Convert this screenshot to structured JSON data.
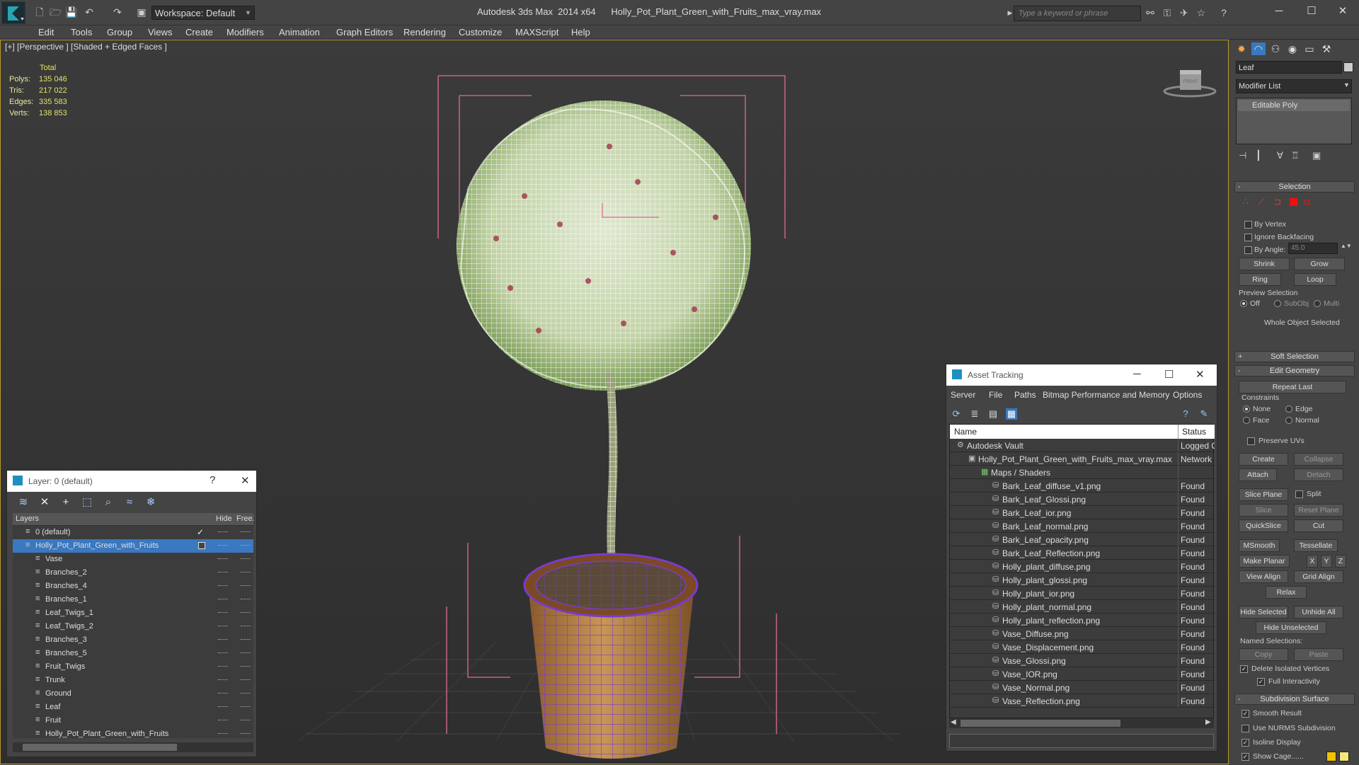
{
  "titlebar": {
    "workspace": "Workspace: Default",
    "app_title": "Autodesk 3ds Max  2014 x64      Holly_Pot_Plant_Green_with_Fruits_max_vray.max",
    "search_placeholder": "Type a keyword or phrase",
    "min": "─",
    "max": "☐",
    "close": "✕"
  },
  "menu": [
    "Edit",
    "Tools",
    "Group",
    "Views",
    "Create",
    "Modifiers",
    "Animation",
    "Graph Editors",
    "Rendering",
    "Customize",
    "MAXScript",
    "Help"
  ],
  "viewport": {
    "label": "[+] [Perspective ] [Shaded + Edged Faces ]",
    "viewcube_label": "FRONT",
    "stats": {
      "header": "Total",
      "rows": [
        {
          "label": "Polys:",
          "value": "135 046"
        },
        {
          "label": "Tris:",
          "value": "217 022"
        },
        {
          "label": "Edges:",
          "value": "335 583"
        },
        {
          "label": "Verts:",
          "value": "138 853"
        }
      ]
    },
    "colors": {
      "leaf": "#7a9c55",
      "wire": "#ffffff",
      "pot": "#b27b3b",
      "potwire": "#7a3ad0",
      "bbox": "#e06a9a"
    }
  },
  "layer_panel": {
    "title": "Layer: 0 (default)",
    "help": "?",
    "close": "✕",
    "col_layers": "Layers",
    "col_hide": "Hide",
    "col_freeze": "Freeze",
    "layers": [
      {
        "name": "0 (default)",
        "indent": 1,
        "check": "✓"
      },
      {
        "name": "Holly_Pot_Plant_Green_with_Fruits",
        "indent": 1,
        "selected": true
      },
      {
        "name": "Vase",
        "indent": 2
      },
      {
        "name": "Branches_2",
        "indent": 2
      },
      {
        "name": "Branches_4",
        "indent": 2
      },
      {
        "name": "Branches_1",
        "indent": 2
      },
      {
        "name": "Leaf_Twigs_1",
        "indent": 2
      },
      {
        "name": "Leaf_Twigs_2",
        "indent": 2
      },
      {
        "name": "Branches_3",
        "indent": 2
      },
      {
        "name": "Branches_5",
        "indent": 2
      },
      {
        "name": "Fruit_Twigs",
        "indent": 2
      },
      {
        "name": "Trunk",
        "indent": 2
      },
      {
        "name": "Ground",
        "indent": 2
      },
      {
        "name": "Leaf",
        "indent": 2
      },
      {
        "name": "Fruit",
        "indent": 2
      },
      {
        "name": "Holly_Pot_Plant_Green_with_Fruits",
        "indent": 2
      }
    ]
  },
  "asset_panel": {
    "title": "Asset Tracking",
    "min": "─",
    "max": "☐",
    "close": "✕",
    "menu": [
      "Server",
      "File",
      "Paths",
      "Bitmap Performance and Memory",
      "Options"
    ],
    "col_name": "Name",
    "col_status": "Status",
    "rows": [
      {
        "name": "Autodesk Vault",
        "status": "Logged Out",
        "indent": 1
      },
      {
        "name": "Holly_Pot_Plant_Green_with_Fruits_max_vray.max",
        "status": "Network Path",
        "indent": 2
      },
      {
        "name": "Maps / Shaders",
        "status": "",
        "indent": 3
      },
      {
        "name": "Bark_Leaf_diffuse_v1.png",
        "status": "Found",
        "indent": 4
      },
      {
        "name": "Bark_Leaf_Glossi.png",
        "status": "Found",
        "indent": 4
      },
      {
        "name": "Bark_Leaf_ior.png",
        "status": "Found",
        "indent": 4
      },
      {
        "name": "Bark_Leaf_normal.png",
        "status": "Found",
        "indent": 4
      },
      {
        "name": "Bark_Leaf_opacity.png",
        "status": "Found",
        "indent": 4
      },
      {
        "name": "Bark_Leaf_Reflection.png",
        "status": "Found",
        "indent": 4
      },
      {
        "name": "Holly_plant_diffuse.png",
        "status": "Found",
        "indent": 4
      },
      {
        "name": "Holly_plant_glossi.png",
        "status": "Found",
        "indent": 4
      },
      {
        "name": "Holly_plant_ior.png",
        "status": "Found",
        "indent": 4
      },
      {
        "name": "Holly_plant_normal.png",
        "status": "Found",
        "indent": 4
      },
      {
        "name": "Holly_plant_reflection.png",
        "status": "Found",
        "indent": 4
      },
      {
        "name": "Vase_Diffuse.png",
        "status": "Found",
        "indent": 4
      },
      {
        "name": "Vase_Displacement.png",
        "status": "Found",
        "indent": 4
      },
      {
        "name": "Vase_Glossi.png",
        "status": "Found",
        "indent": 4
      },
      {
        "name": "Vase_IOR.png",
        "status": "Found",
        "indent": 4
      },
      {
        "name": "Vase_Normal.png",
        "status": "Found",
        "indent": 4
      },
      {
        "name": "Vase_Reflection.png",
        "status": "Found",
        "indent": 4
      }
    ]
  },
  "command_panel": {
    "object_name": "Leaf",
    "modifier_list": "Modifier List",
    "stack_item": "Editable Poly",
    "selection": {
      "title": "Selection",
      "by_vertex": "By Vertex",
      "ignore_backfacing": "Ignore Backfacing",
      "by_angle": "By Angle:",
      "angle_value": "45.0",
      "shrink": "Shrink",
      "grow": "Grow",
      "ring": "Ring",
      "loop": "Loop",
      "preview_selection": "Preview Selection",
      "off": "Off",
      "subobj": "SubObj",
      "multi": "Multi",
      "whole_object": "Whole Object Selected"
    },
    "soft_selection": "Soft Selection",
    "edit_geometry": {
      "title": "Edit Geometry",
      "repeat_last": "Repeat Last",
      "constraints": "Constraints",
      "none": "None",
      "edge": "Edge",
      "face": "Face",
      "normal": "Normal",
      "preserve_uvs": "Preserve UVs",
      "create": "Create",
      "collapse": "Collapse",
      "attach": "Attach",
      "detach": "Detach",
      "slice_plane": "Slice Plane",
      "split": "Split",
      "slice": "Slice",
      "reset_plane": "Reset Plane",
      "quickslice": "QuickSlice",
      "cut": "Cut",
      "msmooth": "MSmooth",
      "tessellate": "Tessellate",
      "make_planar": "Make Planar",
      "x": "X",
      "y": "Y",
      "z": "Z",
      "view_align": "View Align",
      "grid_align": "Grid Align",
      "relax": "Relax",
      "hide_selected": "Hide Selected",
      "unhide_all": "Unhide All",
      "hide_unselected": "Hide Unselected",
      "named_selections": "Named Selections:",
      "copy": "Copy",
      "paste": "Paste",
      "delete_isolated": "Delete Isolated Vertices",
      "full_interactivity": "Full Interactivity"
    },
    "subdivision": {
      "title": "Subdivision Surface",
      "smooth_result": "Smooth Result",
      "use_nurms": "Use NURMS Subdivision",
      "isoline_display": "Isoline Display",
      "show_cage": "Show Cage......"
    }
  }
}
